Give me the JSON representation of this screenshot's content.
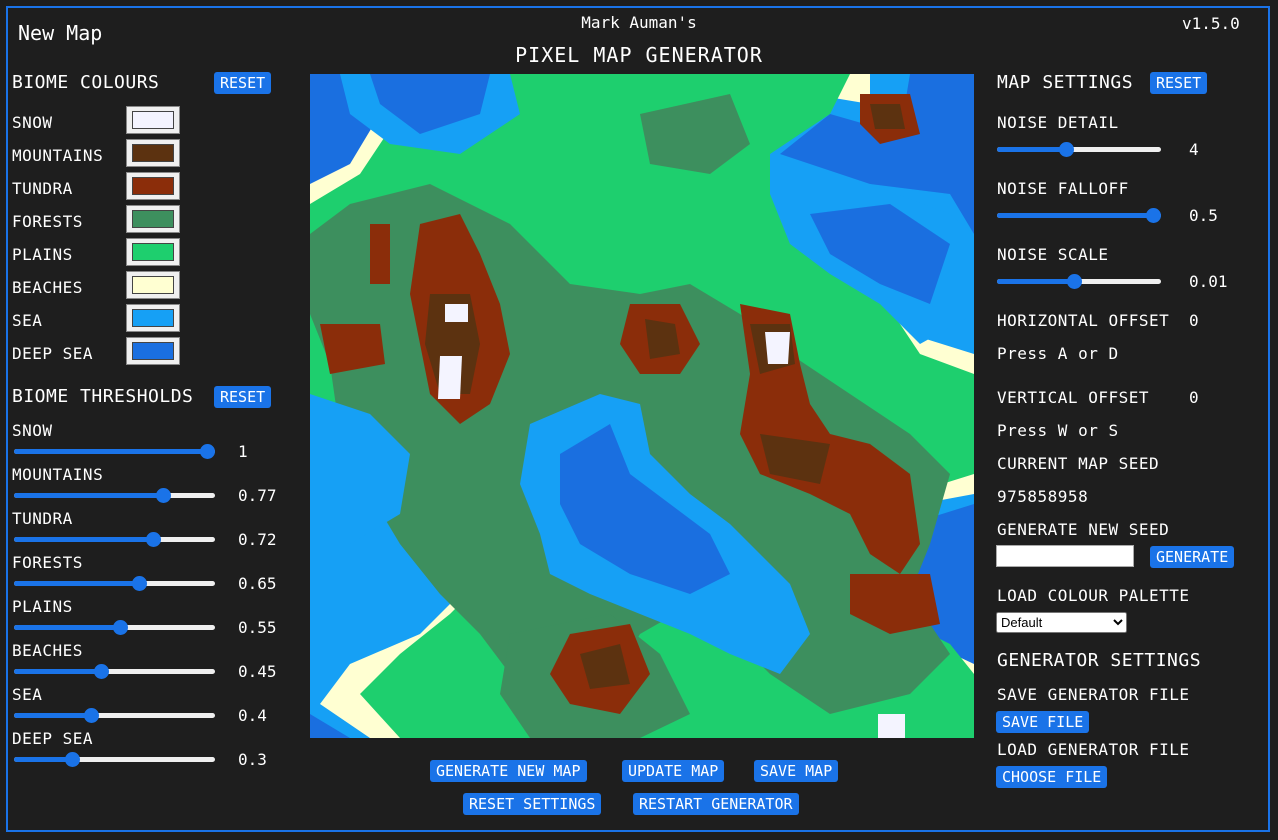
{
  "header": {
    "new_map": "New Map",
    "author": "Mark Auman's",
    "title": "PIXEL MAP GENERATOR",
    "version": "v1.5.0"
  },
  "biome_colours": {
    "heading": "BIOME COLOURS",
    "reset": "RESET",
    "items": [
      {
        "label": "SNOW",
        "color": "#f4f4ff"
      },
      {
        "label": "MOUNTAINS",
        "color": "#5c3210"
      },
      {
        "label": "TUNDRA",
        "color": "#8b2d0a"
      },
      {
        "label": "FORESTS",
        "color": "#3d8f5e"
      },
      {
        "label": "PLAINS",
        "color": "#1ecf6e"
      },
      {
        "label": "BEACHES",
        "color": "#ffffd2"
      },
      {
        "label": "SEA",
        "color": "#16a0f5"
      },
      {
        "label": "DEEP SEA",
        "color": "#1a6fe0"
      }
    ]
  },
  "biome_thresholds": {
    "heading": "BIOME THRESHOLDS",
    "reset": "RESET",
    "min": 0,
    "max": 1,
    "items": [
      {
        "label": "SNOW",
        "value": 1
      },
      {
        "label": "MOUNTAINS",
        "value": 0.77
      },
      {
        "label": "TUNDRA",
        "value": 0.72
      },
      {
        "label": "FORESTS",
        "value": 0.65
      },
      {
        "label": "PLAINS",
        "value": 0.55
      },
      {
        "label": "BEACHES",
        "value": 0.45
      },
      {
        "label": "SEA",
        "value": 0.4
      },
      {
        "label": "DEEP SEA",
        "value": 0.3
      }
    ]
  },
  "map_settings": {
    "heading": "MAP SETTINGS",
    "reset": "RESET",
    "noise_detail": {
      "label": "NOISE DETAIL",
      "value": 4,
      "fraction": 0.42
    },
    "noise_falloff": {
      "label": "NOISE FALLOFF",
      "value": 0.5,
      "fraction": 0.95
    },
    "noise_scale": {
      "label": "NOISE SCALE",
      "value": 0.01,
      "fraction": 0.47
    },
    "horizontal_offset": {
      "label": "HORIZONTAL OFFSET",
      "value": "0",
      "hint": "Press A or D"
    },
    "vertical_offset": {
      "label": "VERTICAL OFFSET",
      "value": "0",
      "hint": "Press W or S"
    },
    "current_seed_label": "CURRENT MAP SEED",
    "current_seed": "975858958",
    "new_seed_label": "GENERATE NEW SEED",
    "new_seed_value": "",
    "generate": "GENERATE",
    "palette_label": "LOAD COLOUR PALETTE",
    "palette_selected": "Default"
  },
  "generator_settings": {
    "heading": "GENERATOR SETTINGS",
    "save_label": "SAVE GENERATOR FILE",
    "save_button": "SAVE FILE",
    "load_label": "LOAD GENERATOR FILE",
    "load_button": "CHOOSE FILE"
  },
  "actions": {
    "generate_new_map": "GENERATE NEW MAP",
    "update_map": "UPDATE MAP",
    "save_map": "SAVE MAP",
    "reset_settings": "RESET SETTINGS",
    "restart_generator": "RESTART GENERATOR"
  }
}
